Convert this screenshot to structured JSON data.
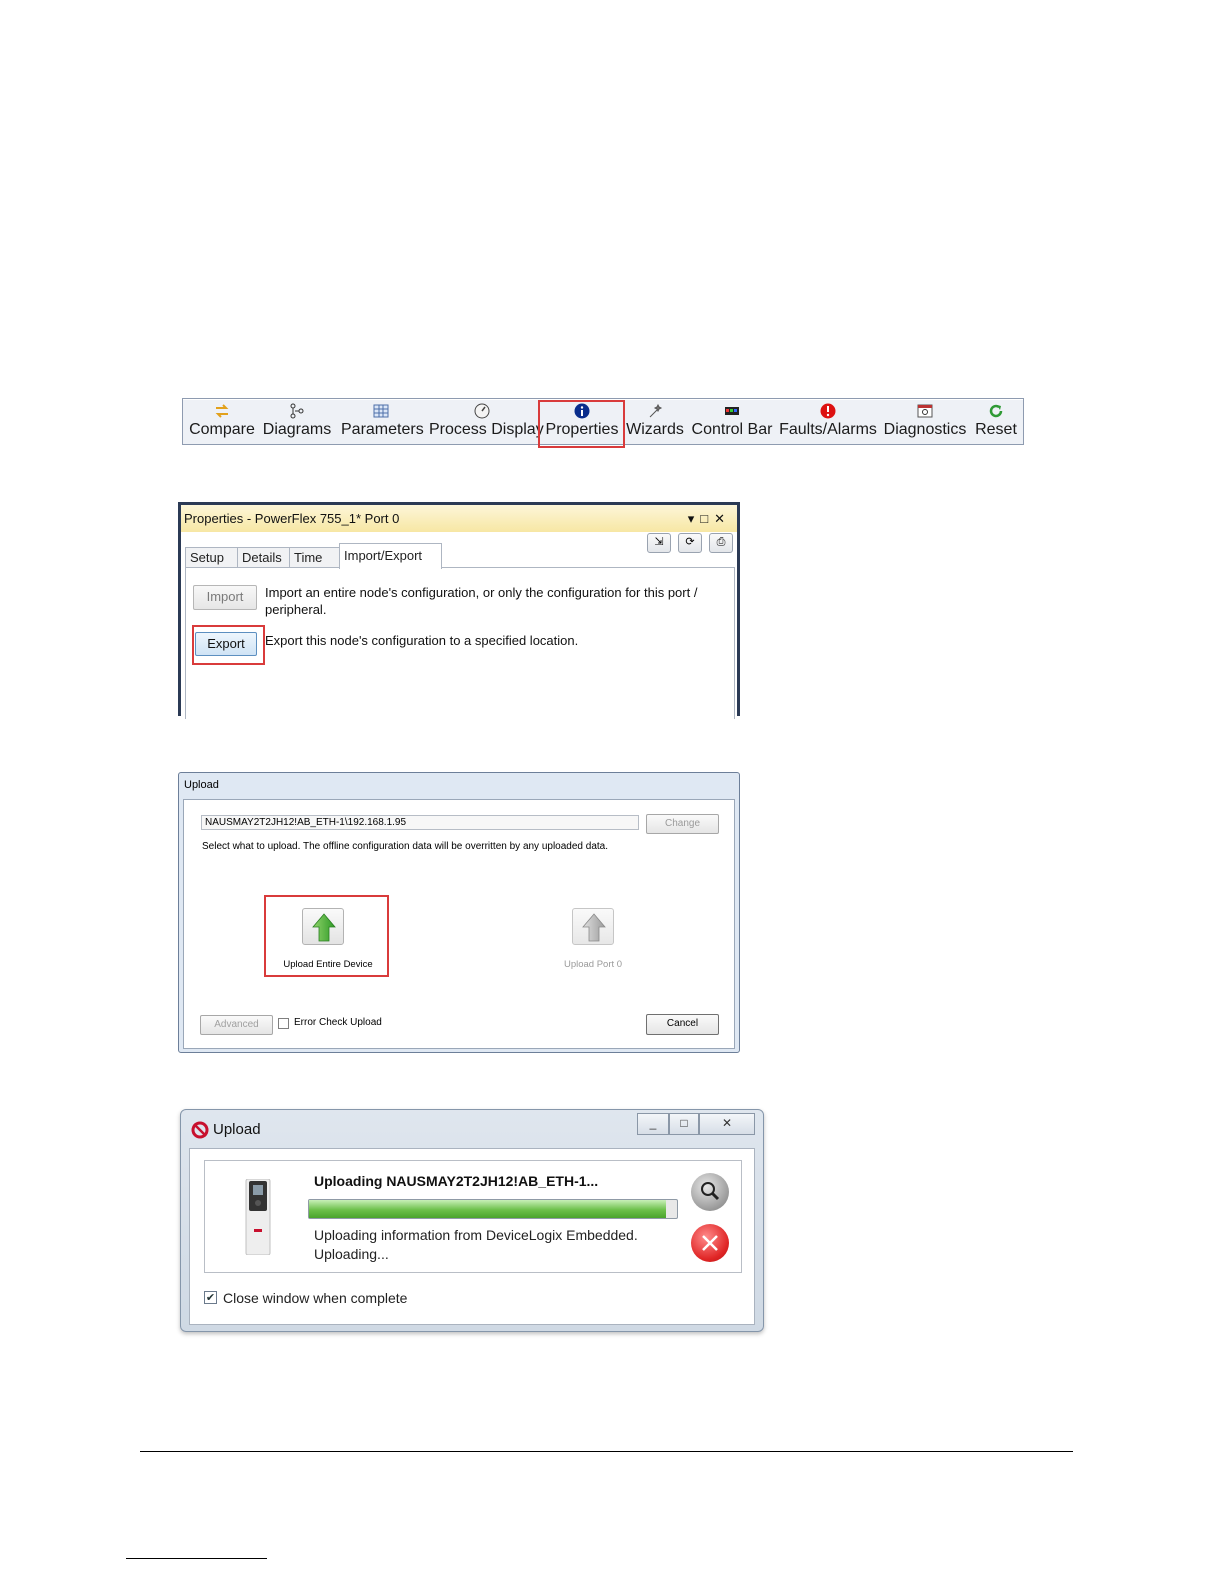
{
  "toolbar": {
    "items": [
      {
        "label": "Compare",
        "icon": "compare-icon"
      },
      {
        "label": "Diagrams",
        "icon": "diagrams-icon"
      },
      {
        "label": "Parameters",
        "icon": "parameters-icon"
      },
      {
        "label": "Process Display",
        "icon": "process-display-icon"
      },
      {
        "label": "Properties",
        "icon": "info-icon"
      },
      {
        "label": "Wizards",
        "icon": "wizards-icon"
      },
      {
        "label": "Control Bar",
        "icon": "control-bar-icon"
      },
      {
        "label": "Faults/Alarms",
        "icon": "fault-alarm-icon"
      },
      {
        "label": "Diagnostics",
        "icon": "diagnostics-icon"
      },
      {
        "label": "Reset",
        "icon": "reset-icon"
      }
    ],
    "highlighted": "Properties",
    "highlight_color": "#d93b3b"
  },
  "properties_window": {
    "title": "Properties - PowerFlex 755_1* Port 0",
    "tabs": [
      "Setup",
      "Details",
      "Time",
      "Import/Export"
    ],
    "active_tab": "Import/Export",
    "import_button": "Import",
    "import_desc_line1": "Import an entire node's configuration, or only the configuration for this port /",
    "import_desc_line2": "peripheral.",
    "export_button": "Export",
    "export_desc": "Export this node's configuration to a specified location."
  },
  "upload_dialog": {
    "title": "Upload",
    "path": "NAUSMAY2T2JH12!AB_ETH-1\\192.168.1.95",
    "change_button": "Change",
    "message": "Select what to upload.  The offline configuration data will be overritten by any uploaded data.",
    "option_entire": "Upload Entire Device",
    "option_port": "Upload Port 0",
    "advanced_button": "Advanced",
    "error_check_label": "Error Check Upload",
    "error_check_checked": false,
    "cancel_button": "Cancel"
  },
  "progress_dialog": {
    "title": "Upload",
    "heading": "Uploading NAUSMAY2T2JH12!AB_ETH-1...",
    "progress": 0.97,
    "status_line1": "Uploading information from DeviceLogix Embedded.",
    "status_line2": "Uploading...",
    "close_when_complete_label": "Close window when complete",
    "close_when_complete_checked": true
  }
}
